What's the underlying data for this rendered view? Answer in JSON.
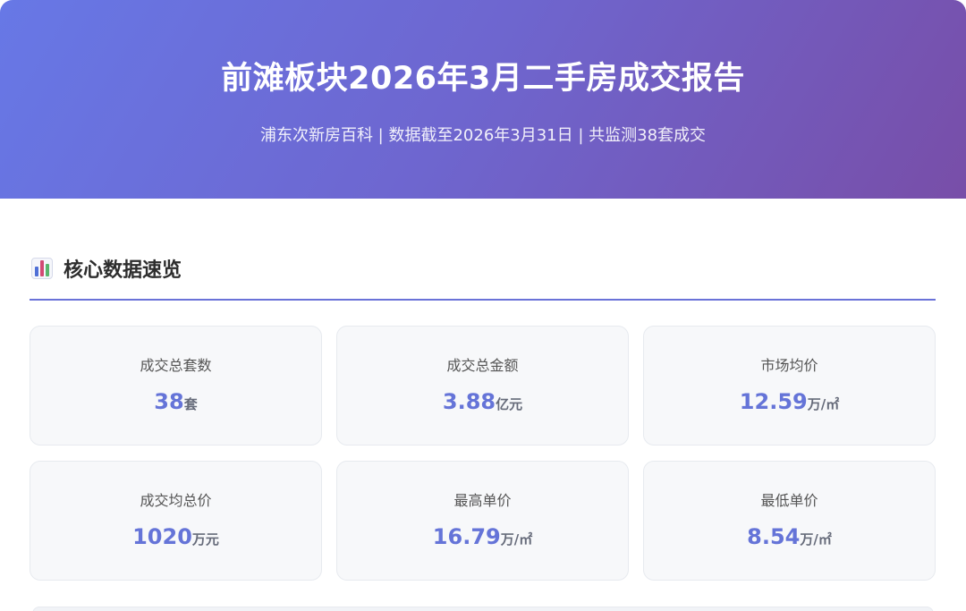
{
  "header": {
    "title": "前滩板块2026年3月二手房成交报告",
    "subtitle": "浦东次新房百科 | 数据截至2026年3月31日 | 共监测38套成交"
  },
  "section": {
    "icon": "bar-chart-icon",
    "title": "核心数据速览"
  },
  "stats": [
    {
      "label": "成交总套数",
      "value": "38",
      "unit": "套"
    },
    {
      "label": "成交总金额",
      "value": "3.88",
      "unit": "亿元"
    },
    {
      "label": "市场均价",
      "value": "12.59",
      "unit": "万/㎡"
    },
    {
      "label": "成交均总价",
      "value": "1020",
      "unit": "万元"
    },
    {
      "label": "最高单价",
      "value": "16.79",
      "unit": "万/㎡"
    },
    {
      "label": "最低单价",
      "value": "8.54",
      "unit": "万/㎡"
    }
  ],
  "colors": {
    "accent": "#6574d8",
    "header_gradient_start": "#6778e6",
    "header_gradient_end": "#784ea8"
  }
}
